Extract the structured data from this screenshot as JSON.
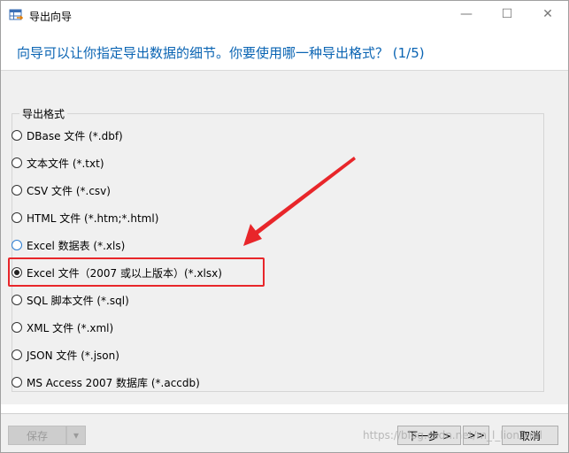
{
  "window": {
    "title": "导出向导",
    "minimize": "—",
    "maximize": "☐",
    "close": "✕"
  },
  "heading": "向导可以让你指定导出数据的细节。你要使用哪一种导出格式？ (1/5)",
  "group": {
    "legend": "导出格式",
    "options": [
      {
        "label": "DBase 文件 (*.dbf)",
        "checked": false
      },
      {
        "label": "文本文件 (*.txt)",
        "checked": false
      },
      {
        "label": "CSV 文件 (*.csv)",
        "checked": false
      },
      {
        "label": "HTML 文件 (*.htm;*.html)",
        "checked": false
      },
      {
        "label": "Excel 数据表 (*.xls)",
        "checked": false
      },
      {
        "label": "Excel 文件（2007 或以上版本）(*.xlsx)",
        "checked": true
      },
      {
        "label": "SQL 脚本文件 (*.sql)",
        "checked": false
      },
      {
        "label": "XML 文件 (*.xml)",
        "checked": false
      },
      {
        "label": "JSON 文件 (*.json)",
        "checked": false
      },
      {
        "label": "MS Access 2007 数据库 (*.accdb)",
        "checked": false
      }
    ]
  },
  "footer": {
    "save_label": "保存",
    "save_dropdown": "▾",
    "next_label": "下一步 >",
    "last_label": ">>",
    "cancel_label": "取消"
  },
  "watermark": "https://blog.csdn.net/m_l_lion.xml",
  "colors": {
    "heading": "#0a64b3",
    "annotation": "#e8262a"
  },
  "icons": {
    "app": "table-export-icon",
    "annotation": "red-arrow-annotation"
  }
}
